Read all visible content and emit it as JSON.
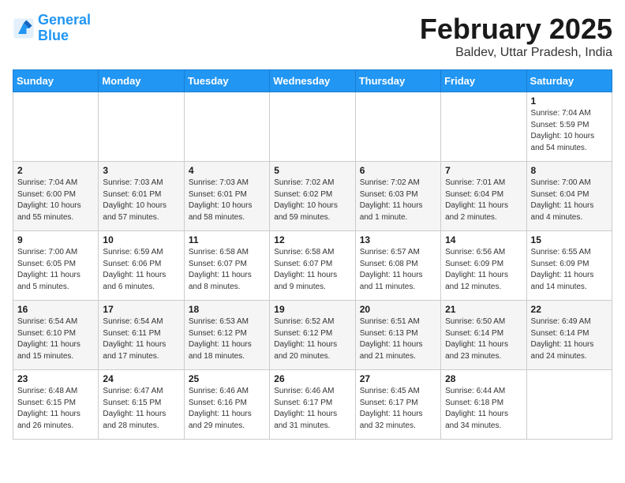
{
  "logo": {
    "line1": "General",
    "line2": "Blue"
  },
  "title": "February 2025",
  "subtitle": "Baldev, Uttar Pradesh, India",
  "days_of_week": [
    "Sunday",
    "Monday",
    "Tuesday",
    "Wednesday",
    "Thursday",
    "Friday",
    "Saturday"
  ],
  "weeks": [
    [
      {
        "num": "",
        "info": ""
      },
      {
        "num": "",
        "info": ""
      },
      {
        "num": "",
        "info": ""
      },
      {
        "num": "",
        "info": ""
      },
      {
        "num": "",
        "info": ""
      },
      {
        "num": "",
        "info": ""
      },
      {
        "num": "1",
        "info": "Sunrise: 7:04 AM\nSunset: 5:59 PM\nDaylight: 10 hours\nand 54 minutes."
      }
    ],
    [
      {
        "num": "2",
        "info": "Sunrise: 7:04 AM\nSunset: 6:00 PM\nDaylight: 10 hours\nand 55 minutes."
      },
      {
        "num": "3",
        "info": "Sunrise: 7:03 AM\nSunset: 6:01 PM\nDaylight: 10 hours\nand 57 minutes."
      },
      {
        "num": "4",
        "info": "Sunrise: 7:03 AM\nSunset: 6:01 PM\nDaylight: 10 hours\nand 58 minutes."
      },
      {
        "num": "5",
        "info": "Sunrise: 7:02 AM\nSunset: 6:02 PM\nDaylight: 10 hours\nand 59 minutes."
      },
      {
        "num": "6",
        "info": "Sunrise: 7:02 AM\nSunset: 6:03 PM\nDaylight: 11 hours\nand 1 minute."
      },
      {
        "num": "7",
        "info": "Sunrise: 7:01 AM\nSunset: 6:04 PM\nDaylight: 11 hours\nand 2 minutes."
      },
      {
        "num": "8",
        "info": "Sunrise: 7:00 AM\nSunset: 6:04 PM\nDaylight: 11 hours\nand 4 minutes."
      }
    ],
    [
      {
        "num": "9",
        "info": "Sunrise: 7:00 AM\nSunset: 6:05 PM\nDaylight: 11 hours\nand 5 minutes."
      },
      {
        "num": "10",
        "info": "Sunrise: 6:59 AM\nSunset: 6:06 PM\nDaylight: 11 hours\nand 6 minutes."
      },
      {
        "num": "11",
        "info": "Sunrise: 6:58 AM\nSunset: 6:07 PM\nDaylight: 11 hours\nand 8 minutes."
      },
      {
        "num": "12",
        "info": "Sunrise: 6:58 AM\nSunset: 6:07 PM\nDaylight: 11 hours\nand 9 minutes."
      },
      {
        "num": "13",
        "info": "Sunrise: 6:57 AM\nSunset: 6:08 PM\nDaylight: 11 hours\nand 11 minutes."
      },
      {
        "num": "14",
        "info": "Sunrise: 6:56 AM\nSunset: 6:09 PM\nDaylight: 11 hours\nand 12 minutes."
      },
      {
        "num": "15",
        "info": "Sunrise: 6:55 AM\nSunset: 6:09 PM\nDaylight: 11 hours\nand 14 minutes."
      }
    ],
    [
      {
        "num": "16",
        "info": "Sunrise: 6:54 AM\nSunset: 6:10 PM\nDaylight: 11 hours\nand 15 minutes."
      },
      {
        "num": "17",
        "info": "Sunrise: 6:54 AM\nSunset: 6:11 PM\nDaylight: 11 hours\nand 17 minutes."
      },
      {
        "num": "18",
        "info": "Sunrise: 6:53 AM\nSunset: 6:12 PM\nDaylight: 11 hours\nand 18 minutes."
      },
      {
        "num": "19",
        "info": "Sunrise: 6:52 AM\nSunset: 6:12 PM\nDaylight: 11 hours\nand 20 minutes."
      },
      {
        "num": "20",
        "info": "Sunrise: 6:51 AM\nSunset: 6:13 PM\nDaylight: 11 hours\nand 21 minutes."
      },
      {
        "num": "21",
        "info": "Sunrise: 6:50 AM\nSunset: 6:14 PM\nDaylight: 11 hours\nand 23 minutes."
      },
      {
        "num": "22",
        "info": "Sunrise: 6:49 AM\nSunset: 6:14 PM\nDaylight: 11 hours\nand 24 minutes."
      }
    ],
    [
      {
        "num": "23",
        "info": "Sunrise: 6:48 AM\nSunset: 6:15 PM\nDaylight: 11 hours\nand 26 minutes."
      },
      {
        "num": "24",
        "info": "Sunrise: 6:47 AM\nSunset: 6:15 PM\nDaylight: 11 hours\nand 28 minutes."
      },
      {
        "num": "25",
        "info": "Sunrise: 6:46 AM\nSunset: 6:16 PM\nDaylight: 11 hours\nand 29 minutes."
      },
      {
        "num": "26",
        "info": "Sunrise: 6:46 AM\nSunset: 6:17 PM\nDaylight: 11 hours\nand 31 minutes."
      },
      {
        "num": "27",
        "info": "Sunrise: 6:45 AM\nSunset: 6:17 PM\nDaylight: 11 hours\nand 32 minutes."
      },
      {
        "num": "28",
        "info": "Sunrise: 6:44 AM\nSunset: 6:18 PM\nDaylight: 11 hours\nand 34 minutes."
      },
      {
        "num": "",
        "info": ""
      }
    ]
  ]
}
